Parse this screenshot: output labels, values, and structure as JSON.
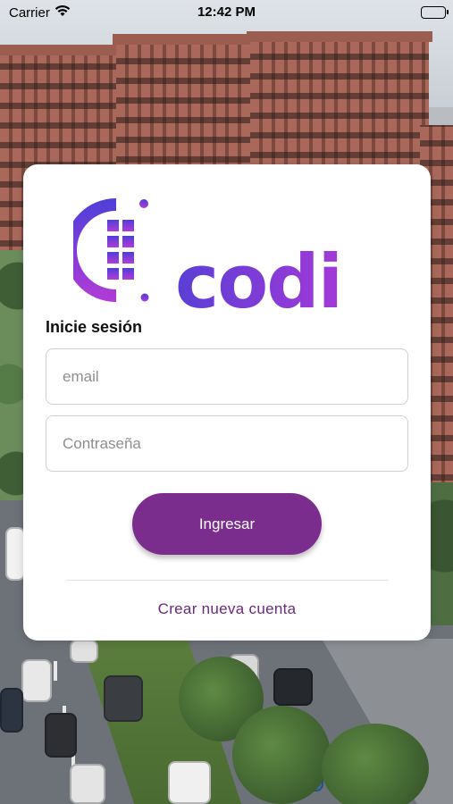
{
  "status_bar": {
    "carrier": "Carrier",
    "time": "12:42 PM",
    "wifi_icon": "wifi-icon",
    "battery_icon": "battery-full-icon"
  },
  "logo": {
    "text": "codi",
    "gradient_start": "#5a3fd6",
    "gradient_end": "#a339d8"
  },
  "login": {
    "title": "Inicie sesión",
    "email_placeholder": "email",
    "email_value": "",
    "password_placeholder": "Contraseña",
    "password_value": "",
    "submit_label": "Ingresar",
    "create_account_label": "Crear nueva cuenta"
  },
  "colors": {
    "primary": "#7b2d8e",
    "link": "#6a2a7c",
    "card_background": "#ffffff"
  }
}
